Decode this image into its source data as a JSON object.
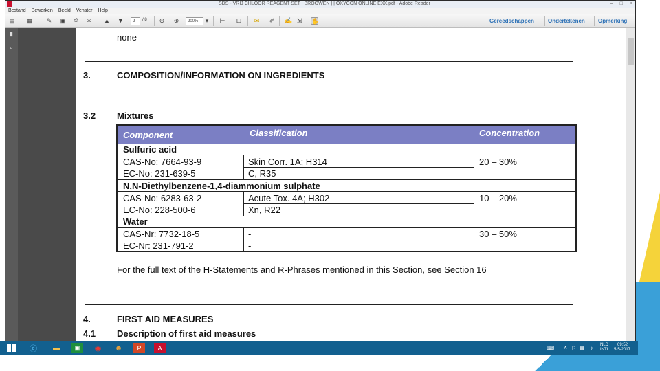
{
  "window": {
    "title": "SDS - VRIJ CHLOOR REAGENT SET | BROOWEN | | OXYCON ONLINE EXX.pdf - Adobe Reader",
    "controls": [
      "–",
      "□",
      "×"
    ]
  },
  "menu": [
    "Bestand",
    "Bewerken",
    "Beeld",
    "Venster",
    "Help"
  ],
  "toolbar": {
    "page_current": "2",
    "page_total": "/ 8",
    "zoom": "200%",
    "links": [
      "Gereedschappen",
      "Ondertekenen",
      "Opmerking"
    ]
  },
  "document": {
    "prev_text": "none",
    "section3": {
      "num": "3.",
      "title": "COMPOSITION/INFORMATION ON INGREDIENTS"
    },
    "section32": {
      "num": "3.2",
      "title": "Mixtures"
    },
    "table": {
      "headers": [
        "Component",
        "Classification",
        "Concentration"
      ],
      "groups": [
        {
          "name": "Sulfuric acid",
          "lines": [
            "CAS-No: 7664-93-9",
            "EC-No:   231-639-5"
          ],
          "classification": [
            "Skin Corr. 1A; H314",
            "C, R35"
          ],
          "concentration": "20 – 30%"
        },
        {
          "name": "N,N-Diethylbenzene-1,4-diammonium sulphate",
          "lines": [
            "CAS-No: 6283-63-2",
            "EC-No:   228-500-6"
          ],
          "classification": [
            "Acute Tox. 4A; H302",
            "Xn, R22"
          ],
          "concentration": "10 – 20%"
        },
        {
          "name": "Water",
          "lines": [
            "CAS-Nr: 7732-18-5",
            "EC-Nr:   231-791-2"
          ],
          "classification": [
            "-",
            "-"
          ],
          "concentration": "30 – 50%"
        }
      ]
    },
    "note": "For the full text of the H-Statements and R-Phrases mentioned in this Section, see Section 16",
    "section4": {
      "num": "4.",
      "title": "FIRST AID MEASURES"
    },
    "section41": {
      "num": "4.1",
      "title": "Description of first aid measures"
    }
  },
  "taskbar": {
    "tray_lang_top": "NLD",
    "tray_lang_bottom": "INTL",
    "time": "09:52",
    "date": "5-5-2017"
  },
  "colors": {
    "table_header": "#7b7fc4",
    "taskbar": "#12608f",
    "accent_yellow": "#f5d33a",
    "link": "#2a6fb5"
  }
}
